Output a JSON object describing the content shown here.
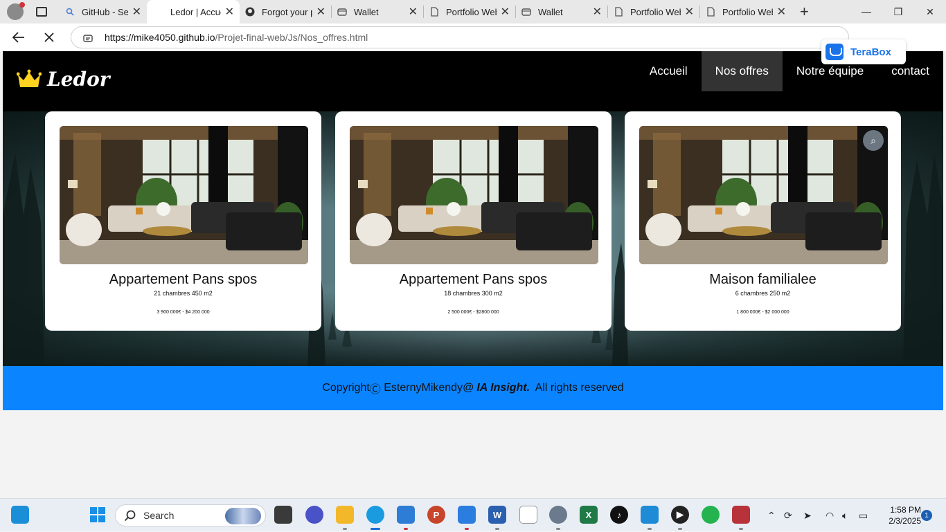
{
  "browser": {
    "tabs": [
      {
        "title": "GitHub - Sear",
        "icon": "search-icon"
      },
      {
        "title": "Ledor | Accue",
        "icon": "none",
        "active": true
      },
      {
        "title": "Forgot your p",
        "icon": "github-icon"
      },
      {
        "title": "Wallet",
        "icon": "wallet-icon"
      },
      {
        "title": "Portfolio Web",
        "icon": "page-icon"
      },
      {
        "title": "Wallet",
        "icon": "wallet-icon"
      },
      {
        "title": "Portfolio Web",
        "icon": "page-icon"
      },
      {
        "title": "Portfolio Web",
        "icon": "page-icon"
      }
    ],
    "url_host": "https://mike4050.github.io",
    "url_path": "/Projet-final-web/Js/Nos_offres.html",
    "terabox_label": "TeraBox"
  },
  "site": {
    "logo_text": "Ledor",
    "nav": [
      {
        "label": "Accueil"
      },
      {
        "label": "Nos offres",
        "active": true
      },
      {
        "label": "Notre équipe"
      },
      {
        "label": "contact"
      }
    ],
    "offers": [
      {
        "title": "Appartement Pans spos",
        "details": "21 chambres 450 m2",
        "price": "3 900 000€ - $4 200 000"
      },
      {
        "title": "Appartement Pans spos",
        "details": "18 chambres 300 m2",
        "price": "2 500 000€ - $2800 000"
      },
      {
        "title": "Maison familialee",
        "details": "6 chambres 250 m2",
        "price": "1 800 000€ - $2 000 000"
      }
    ],
    "footer": {
      "prefix": "Copyright",
      "copyright_symbol": "Ⓒ",
      "author": " EsternyMikendy@",
      "brand": "IA Insight.",
      "suffix": " All rights reserved"
    }
  },
  "taskbar": {
    "search_placeholder": "Search",
    "time": "1:58 PM",
    "date": "2/3/2025",
    "notification_count": "1"
  },
  "colors": {
    "header_bg": "#000000",
    "nav_active_bg": "#333333",
    "footer_bg": "#0a84ff",
    "accent": "#1a73e8"
  }
}
